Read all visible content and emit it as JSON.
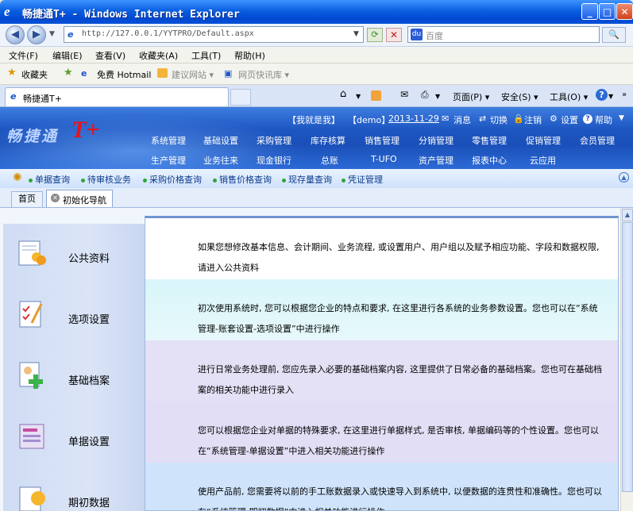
{
  "window": {
    "title": "畅捷通T+ - Windows Internet Explorer"
  },
  "address": {
    "url": "http://127.0.0.1/YYTPRO/Default.aspx",
    "search_placeholder": "百度"
  },
  "menu": [
    "文件(F)",
    "编辑(E)",
    "查看(V)",
    "收藏夹(A)",
    "工具(T)",
    "帮助(H)"
  ],
  "favorites": {
    "label": "收藏夹",
    "links": [
      "免费 Hotmail",
      "建议网站 ▾",
      "网页快讯库 ▾"
    ]
  },
  "tabs": {
    "active": "畅捷通T+"
  },
  "commands": [
    "页面(P) ▾",
    "安全(S) ▾",
    "工具(O) ▾"
  ],
  "app": {
    "logo": "畅捷通",
    "logo_mark": "T+",
    "user": "【我就是我】",
    "account": "【demo】",
    "date": "2013-11-29",
    "messages": "消息",
    "switch": "切换",
    "logout": "注销",
    "settings": "设置",
    "help": "帮助",
    "nav_row1": [
      "系统管理",
      "基础设置",
      "采购管理",
      "库存核算",
      "销售管理",
      "分销管理",
      "零售管理",
      "促销管理",
      "会员管理"
    ],
    "nav_row2": [
      "生产管理",
      "业务往来",
      "现金银行",
      "总账",
      "T-UFO",
      "资产管理",
      "报表中心",
      "云应用"
    ],
    "quick": [
      "单据查询",
      "待审核业务",
      "采购价格查询",
      "销售价格查询",
      "现存量查询",
      "凭证管理"
    ],
    "inner_tabs": {
      "home": "首页",
      "active": "初始化导航"
    }
  },
  "sidebar": [
    {
      "label": "公共资料"
    },
    {
      "label": "选项设置"
    },
    {
      "label": "基础档案"
    },
    {
      "label": "单据设置"
    },
    {
      "label": "期初数据"
    }
  ],
  "descriptions": [
    "如果您想修改基本信息、会计期间、业务流程, 或设置用户、用户组以及赋予相应功能、字段和数据权限, 请进入公共资料",
    "初次使用系统时, 您可以根据您企业的特点和要求, 在这里进行各系统的业务参数设置。您也可以在“系统管理-账套设置-选项设置”中进行操作",
    "进行日常业务处理前, 您应先录入必要的基础档案内容, 这里提供了日常必备的基础档案。您也可在基础档案的相关功能中进行录入",
    "您可以根据您企业对单据的特殊要求, 在这里进行单据样式, 是否审核, 单据编码等的个性设置。您也可以在“系统管理-单据设置”中进入相关功能进行操作",
    "使用产品前, 您需要将以前的手工账数据录入或快速导入到系统中, 以便数据的连贯性和准确性。您也可以在“系统管理-期初数据”中进入相关功能进行操作"
  ],
  "colors": {
    "titlebar": "#0a5fe0",
    "header": "#1e57c2",
    "logo_mark": "#e8131b",
    "row_cyan": "#dff7fb",
    "row_lavender": "#e2def5",
    "row_blue": "#cfe4fb"
  }
}
